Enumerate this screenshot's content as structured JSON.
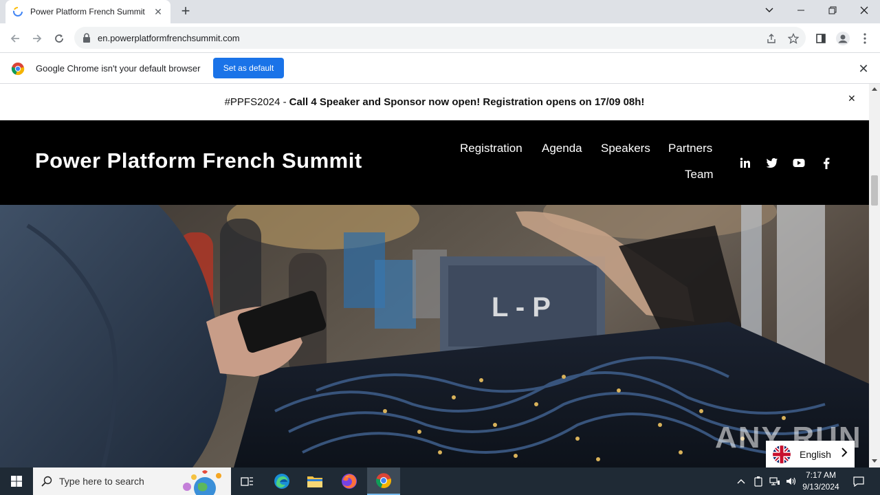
{
  "browser": {
    "tab_title": "Power Platform French Summit",
    "url": "en.powerplatformfrenchsummit.com",
    "infobar_message": "Google Chrome isn't your default browser",
    "infobar_button": "Set as default"
  },
  "announcement": {
    "tag": "#PPFS2024 -",
    "text": "Call 4 Speaker and Sponsor now open! Registration opens on 17/09 08h!"
  },
  "site": {
    "title": "Power Platform French Summit",
    "nav": [
      "Registration",
      "Agenda",
      "Speakers",
      "Partners",
      "Team"
    ],
    "social": [
      "linkedin-icon",
      "twitter-icon",
      "youtube-icon",
      "facebook-icon"
    ]
  },
  "hero": {
    "sign_text": "L - P"
  },
  "language": {
    "selected": "English"
  },
  "watermark": "ANY RUN",
  "taskbar": {
    "search_placeholder": "Type here to search",
    "time": "7:17 AM",
    "date": "9/13/2024"
  },
  "colors": {
    "header_bg": "#000000",
    "chrome_button": "#1a73e8",
    "taskbar_bg": "#1f2a35"
  }
}
